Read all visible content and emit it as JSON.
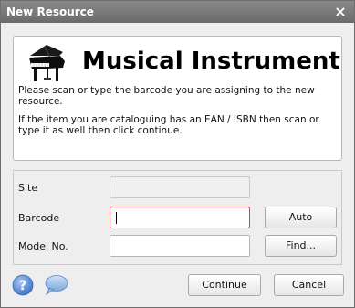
{
  "window": {
    "title": "New Resource"
  },
  "header": {
    "title": "Musical Instrument",
    "icon": "grand-piano-icon",
    "instructions": [
      "Please scan or type the barcode you are assigning to the new resource.",
      "If the item you are cataloguing has an EAN / ISBN then scan or type it as well then click continue."
    ]
  },
  "form": {
    "site": {
      "label": "Site",
      "value": ""
    },
    "barcode": {
      "label": "Barcode",
      "value": ""
    },
    "model": {
      "label": "Model No.",
      "value": ""
    }
  },
  "buttons": {
    "auto": "Auto",
    "find": "Find...",
    "continue": "Continue",
    "cancel": "Cancel"
  },
  "colors": {
    "titlebar": "#7a7a7a",
    "focus_border": "#e04040",
    "help_icon": "#5b8fd6"
  }
}
